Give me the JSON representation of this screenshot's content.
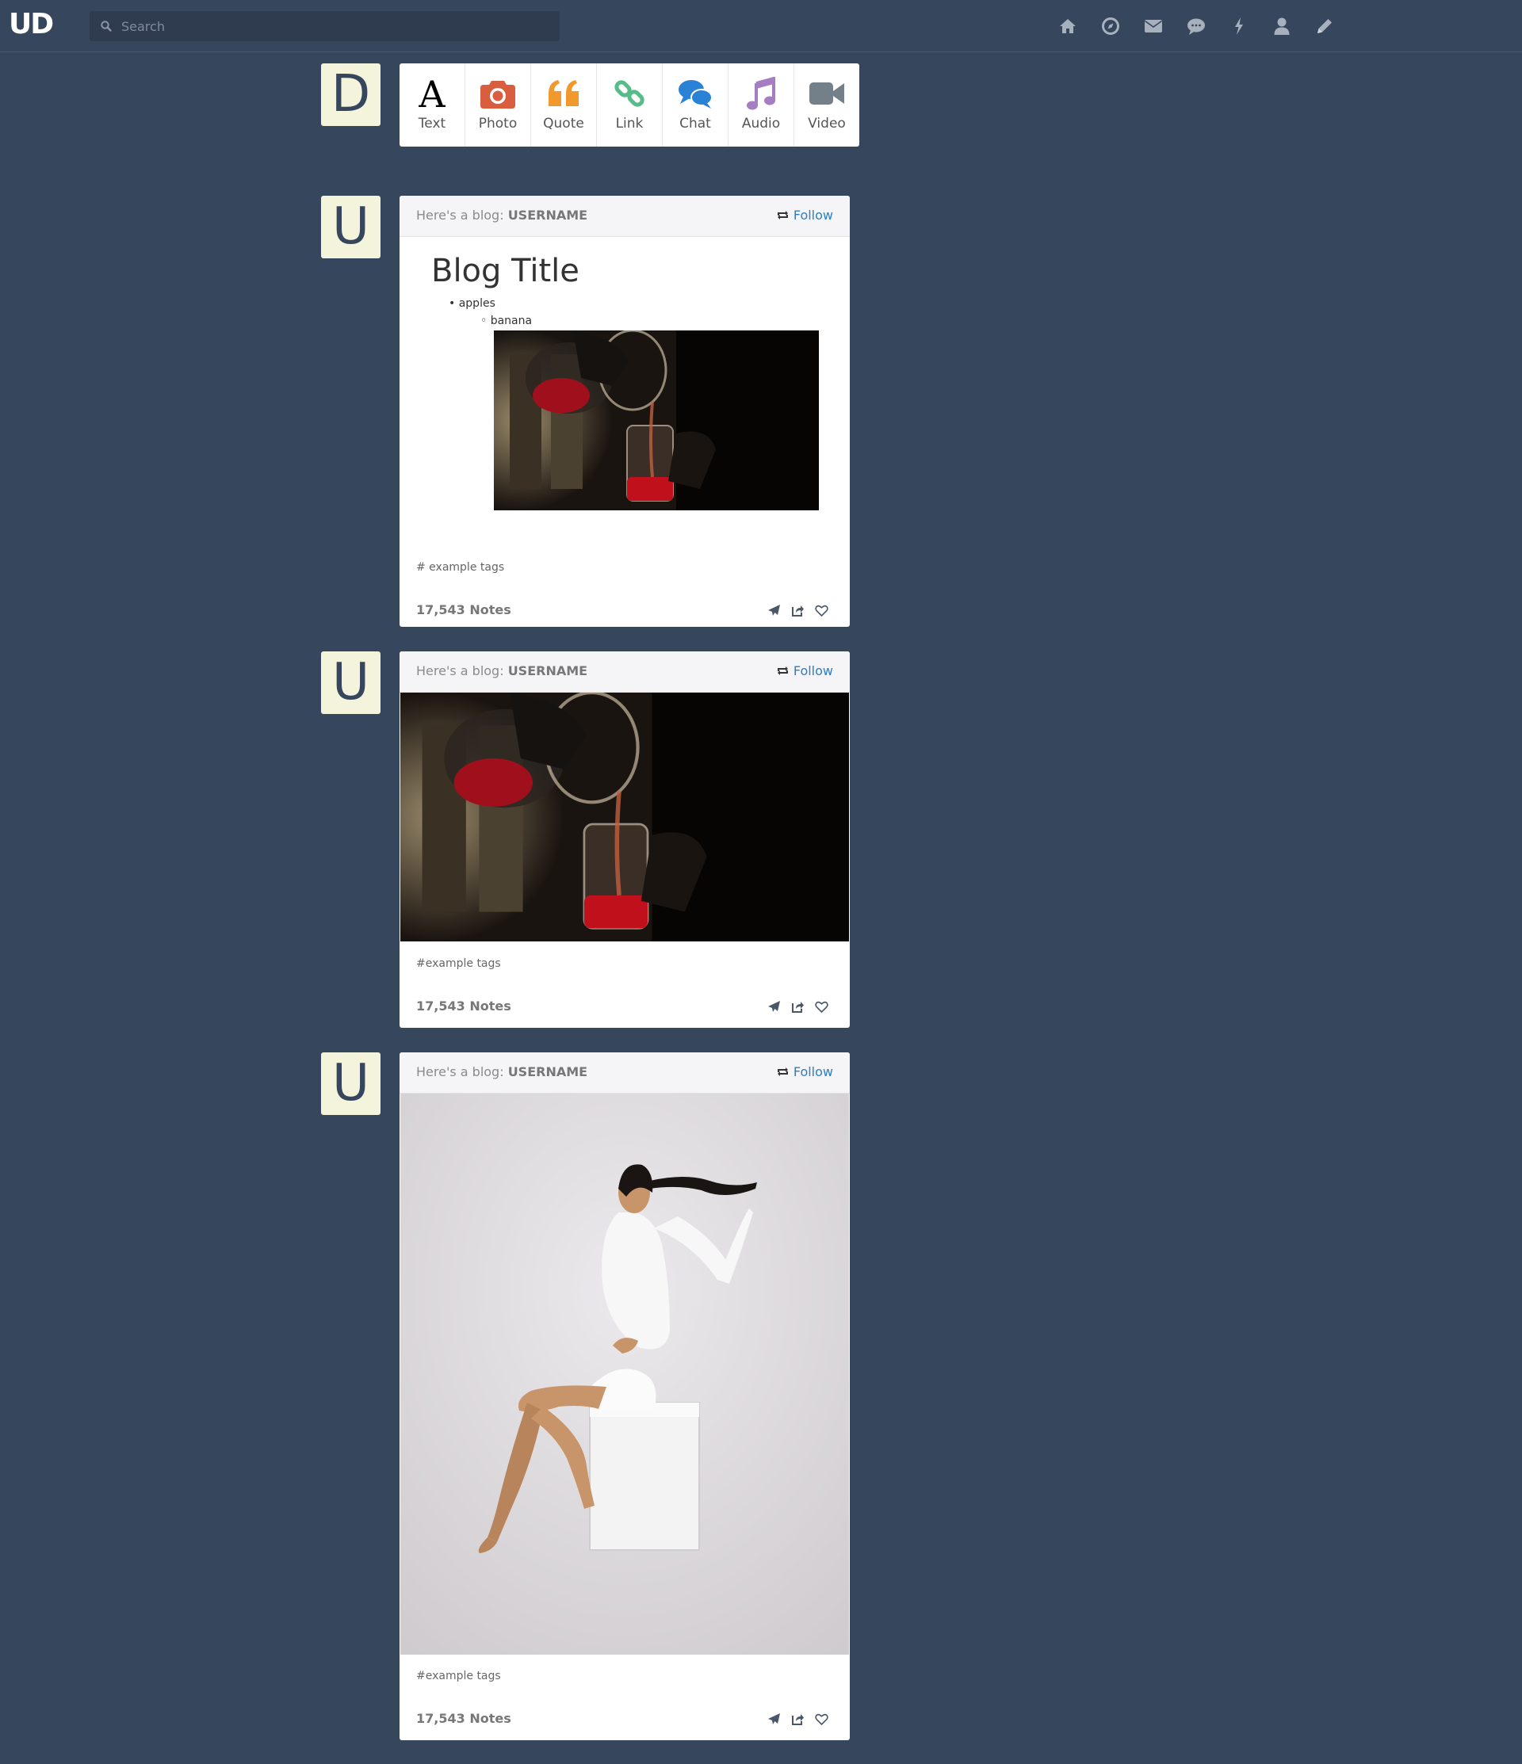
{
  "app": {
    "logo": "UD"
  },
  "search": {
    "placeholder": "Search"
  },
  "nav": [
    "home-icon",
    "compass-icon",
    "mail-icon",
    "chat-bubble-icon",
    "lightning-icon",
    "user-icon",
    "pencil-icon"
  ],
  "composer": {
    "avatar_letter": "D",
    "types": [
      {
        "label": "Text",
        "icon": "text-icon",
        "color": "#000000"
      },
      {
        "label": "Photo",
        "icon": "camera-icon",
        "color": "#d95e40"
      },
      {
        "label": "Quote",
        "icon": "quote-icon",
        "color": "#f2992e"
      },
      {
        "label": "Link",
        "icon": "link-icon",
        "color": "#56bc8a"
      },
      {
        "label": "Chat",
        "icon": "chat-icon",
        "color": "#529ecc"
      },
      {
        "label": "Audio",
        "icon": "music-icon",
        "color": "#a77dc2"
      },
      {
        "label": "Video",
        "icon": "video-camera-icon",
        "color": "#748089"
      }
    ]
  },
  "posts": [
    {
      "avatar_letter": "U",
      "header_prefix": "Here's a blog: ",
      "username": "USERNAME",
      "follow_label": "Follow",
      "title": "Blog Title",
      "list_item": "apples",
      "sub_list_item": "banana",
      "tags": "# example tags",
      "notes": "17,543 Notes"
    },
    {
      "avatar_letter": "U",
      "header_prefix": "Here's a blog: ",
      "username": "USERNAME",
      "follow_label": "Follow",
      "tags": "#example tags",
      "notes": "17,543 Notes"
    },
    {
      "avatar_letter": "U",
      "header_prefix": "Here's a blog: ",
      "username": "USERNAME",
      "follow_label": "Follow",
      "tags": "#example tags",
      "notes": "17,543 Notes"
    }
  ],
  "colors": {
    "background": "#36465d",
    "avatar_bg": "#f4f4dc",
    "link": "#2a7ec8"
  }
}
